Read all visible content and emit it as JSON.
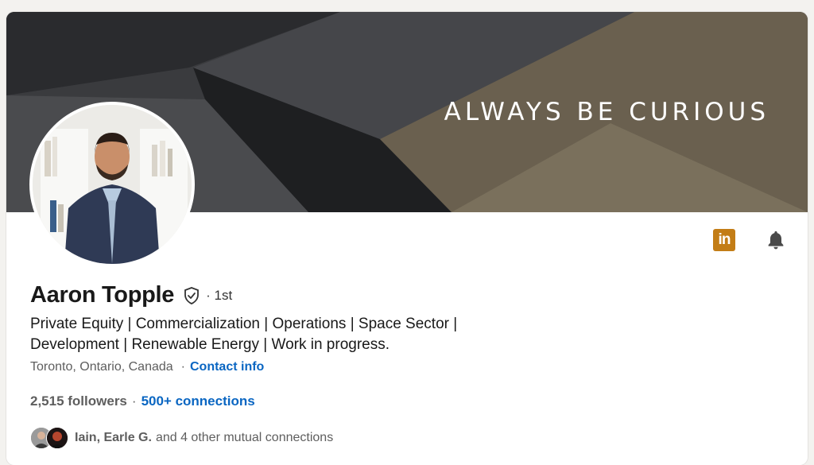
{
  "banner": {
    "tagline": "ALWAYS BE CURIOUS"
  },
  "profile": {
    "name": "Aaron Topple",
    "degree": "· 1st",
    "headline_line1": "Private Equity | Commercialization | Operations | Space Sector |",
    "headline_line2": "Development | Renewable Energy | Work in progress.",
    "location": "Toronto, Ontario, Canada",
    "contact_info": "Contact info",
    "followers": "2,515 followers",
    "connections": "500+ connections",
    "mutual_names": "Iain, Earle G.",
    "mutual_rest": "and 4 other mutual connections"
  },
  "actions": {
    "linkedin_icon_text": "in"
  },
  "colors": {
    "link": "#0a66c2",
    "linkedin_icon": "#c37d16"
  },
  "icons": [
    "verified-shield-icon",
    "linkedin-icon",
    "bell-icon"
  ]
}
